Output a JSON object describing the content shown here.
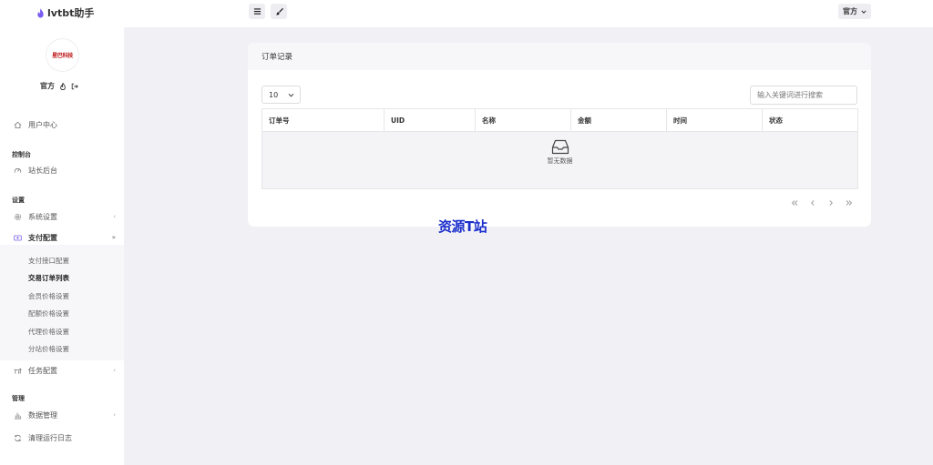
{
  "header": {
    "brand": "lvtbt助手",
    "user_label": "官方"
  },
  "sidebar": {
    "avatar_text": "星巴科技",
    "username": "官方",
    "items": [
      {
        "label": "用户中心"
      },
      {
        "label": "站长后台"
      },
      {
        "label": "系统设置"
      },
      {
        "label": "支付配置"
      },
      {
        "label": "任务配置"
      },
      {
        "label": "数据管理"
      },
      {
        "label": "清理运行日志"
      }
    ],
    "sections": [
      "控制台",
      "设置",
      "管理"
    ],
    "submenu": [
      {
        "label": "支付接口配置"
      },
      {
        "label": "交易订单列表"
      },
      {
        "label": "会员价格设置"
      },
      {
        "label": "配额价格设置"
      },
      {
        "label": "代理价格设置"
      },
      {
        "label": "分站价格设置"
      }
    ]
  },
  "card": {
    "title": "订单记录",
    "page_size": "10",
    "search_placeholder": "输入关键词进行搜索",
    "columns": [
      "订单号",
      "UID",
      "名称",
      "金额",
      "时间",
      "状态"
    ],
    "empty_text": "暂无数据"
  },
  "watermark": "资源T站"
}
